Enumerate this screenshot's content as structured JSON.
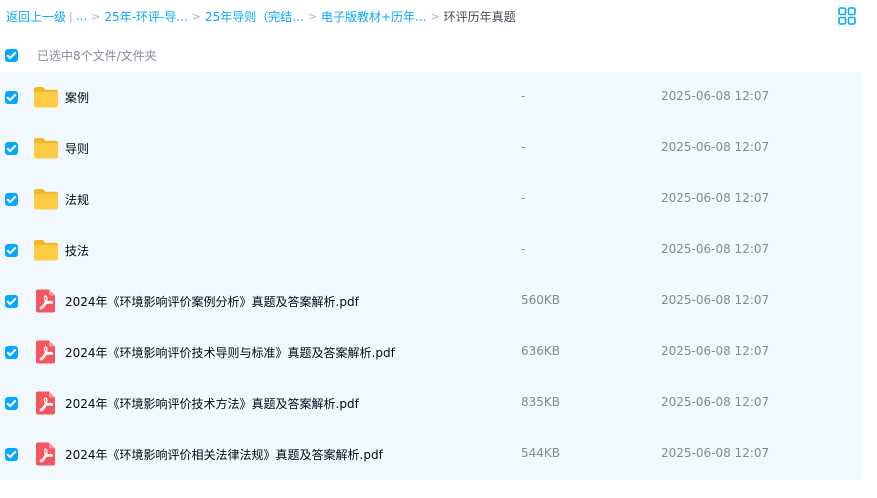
{
  "breadcrumb": {
    "back_label": "返回上一级",
    "divider": "|",
    "ellipsis": "...",
    "items": [
      "25年-环评-导...",
      "25年导则（完结...",
      "电子版教材+历年..."
    ],
    "current": "环评历年真题",
    "separator": ">"
  },
  "selection": {
    "summary_text": "已选中8个文件/文件夹",
    "checked": true
  },
  "colors": {
    "accent": "#06a7ff",
    "row_selected_bg": "#f1f9fe",
    "folder": "#ffc53d",
    "pdf": "#f2575f"
  },
  "files": [
    {
      "type": "folder",
      "icon": "folder-icon",
      "name": "案例",
      "size": "-",
      "date": "2025-06-08 12:07",
      "checked": true
    },
    {
      "type": "folder",
      "icon": "folder-icon",
      "name": "导则",
      "size": "-",
      "date": "2025-06-08 12:07",
      "checked": true
    },
    {
      "type": "folder",
      "icon": "folder-icon",
      "name": "法规",
      "size": "-",
      "date": "2025-06-08 12:07",
      "checked": true
    },
    {
      "type": "folder",
      "icon": "folder-icon",
      "name": "技法",
      "size": "-",
      "date": "2025-06-08 12:07",
      "checked": true
    },
    {
      "type": "pdf",
      "icon": "pdf-icon",
      "name": "2024年《环境影响评价案例分析》真题及答案解析.pdf",
      "size": "560KB",
      "date": "2025-06-08 12:07",
      "checked": true
    },
    {
      "type": "pdf",
      "icon": "pdf-icon",
      "name": "2024年《环境影响评价技术导则与标准》真题及答案解析.pdf",
      "size": "636KB",
      "date": "2025-06-08 12:07",
      "checked": true
    },
    {
      "type": "pdf",
      "icon": "pdf-icon",
      "name": "2024年《环境影响评价技术方法》真题及答案解析.pdf",
      "size": "835KB",
      "date": "2025-06-08 12:07",
      "checked": true
    },
    {
      "type": "pdf",
      "icon": "pdf-icon",
      "name": "2024年《环境影响评价相关法律法规》真题及答案解析.pdf",
      "size": "544KB",
      "date": "2025-06-08 12:07",
      "checked": true
    }
  ]
}
